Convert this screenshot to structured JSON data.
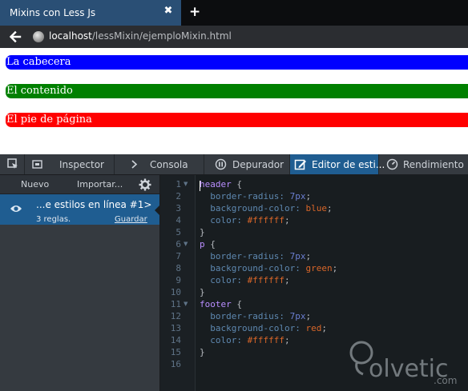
{
  "browser": {
    "tab_title": "Mixins con Less Js",
    "close_glyph": "✖",
    "newtab_glyph": "+",
    "url_host": "localhost",
    "url_path": "/lessMixin/ejemploMixin.html"
  },
  "page": {
    "header_text": "La cabecera",
    "p_text": "El contenido",
    "footer_text": "El pie de página",
    "colors": {
      "header": "#0000ff",
      "p": "#008000",
      "footer": "#ff0000"
    }
  },
  "devtools": {
    "tabs": [
      {
        "label": "Inspector"
      },
      {
        "label": "Consola"
      },
      {
        "label": "Depurador"
      },
      {
        "label": "Editor de esti..."
      },
      {
        "label": "Rendimiento"
      }
    ],
    "selected_tab": "Editor de esti...",
    "style_panel": {
      "new_label": "Nuevo",
      "import_label": "Importar...",
      "sheet_name": "...e estilos en línea #1>",
      "rule_count": "3 reglas.",
      "save_label": "Guardar"
    },
    "editor": {
      "lines": [
        {
          "n": "1",
          "fold": true
        },
        {
          "n": "2"
        },
        {
          "n": "3"
        },
        {
          "n": "4"
        },
        {
          "n": "5"
        },
        {
          "n": "6",
          "fold": true
        },
        {
          "n": "7"
        },
        {
          "n": "8"
        },
        {
          "n": "9"
        },
        {
          "n": "10"
        },
        {
          "n": "11",
          "fold": true
        },
        {
          "n": "12"
        },
        {
          "n": "13"
        },
        {
          "n": "14"
        },
        {
          "n": "15"
        },
        {
          "n": "16"
        }
      ],
      "code": {
        "l1": "header",
        "l1b": " {",
        "l2p": "  border-radius:",
        "l2v": " 7px",
        "l2e": ";",
        "l3p": "  background-color:",
        "l3v": " blue",
        "l3e": ";",
        "l4p": "  color:",
        "l4v": " #ffffff",
        "l4e": ";",
        "l5": "}",
        "l6": "p",
        "l6b": " {",
        "l7p": "  border-radius:",
        "l7v": " 7px",
        "l7e": ";",
        "l8p": "  background-color:",
        "l8v": " green",
        "l8e": ";",
        "l9p": "  color:",
        "l9v": " #ffffff",
        "l9e": ";",
        "l10": "}",
        "l11": "footer",
        "l11b": " {",
        "l12p": "  border-radius:",
        "l12v": " 7px",
        "l12e": ";",
        "l13p": "  background-color:",
        "l13v": " red",
        "l13e": ";",
        "l14p": "  color:",
        "l14v": " #ffffff",
        "l14e": ";",
        "l15": "}"
      }
    }
  },
  "watermark": {
    "text": "olvetic",
    "suffix": ".com"
  }
}
